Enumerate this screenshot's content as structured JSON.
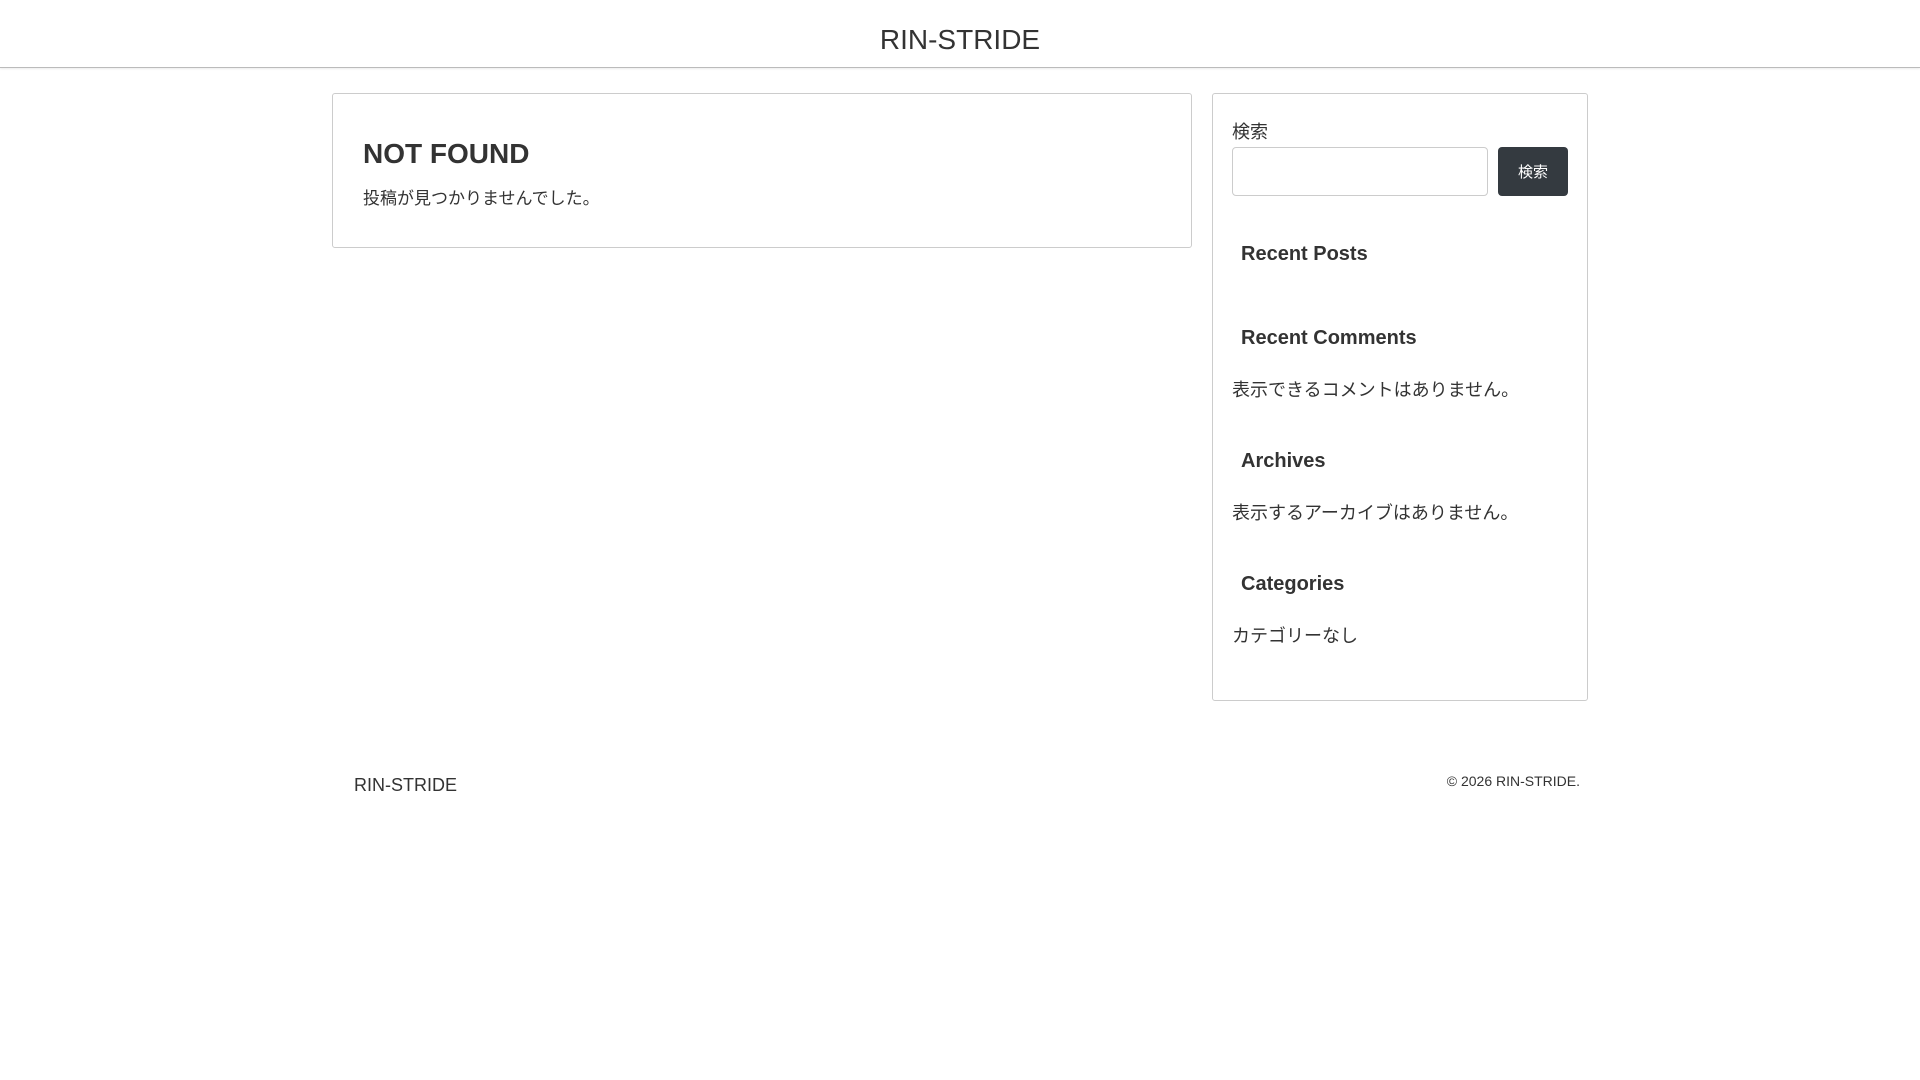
{
  "header": {
    "site_title": "RIN-STRIDE"
  },
  "main": {
    "title": "NOT FOUND",
    "message": "投稿が見つかりませんでした。"
  },
  "sidebar": {
    "search": {
      "label": "検索",
      "input_value": "",
      "button_label": "検索"
    },
    "widgets": [
      {
        "title": "Recent Posts",
        "text": ""
      },
      {
        "title": "Recent Comments",
        "text": "表示できるコメントはありません。"
      },
      {
        "title": "Archives",
        "text": "表示するアーカイブはありません。"
      },
      {
        "title": "Categories",
        "text": "カテゴリーなし"
      }
    ]
  },
  "footer": {
    "site_name": "RIN-STRIDE",
    "copyright": "© 2026 RIN-STRIDE."
  }
}
